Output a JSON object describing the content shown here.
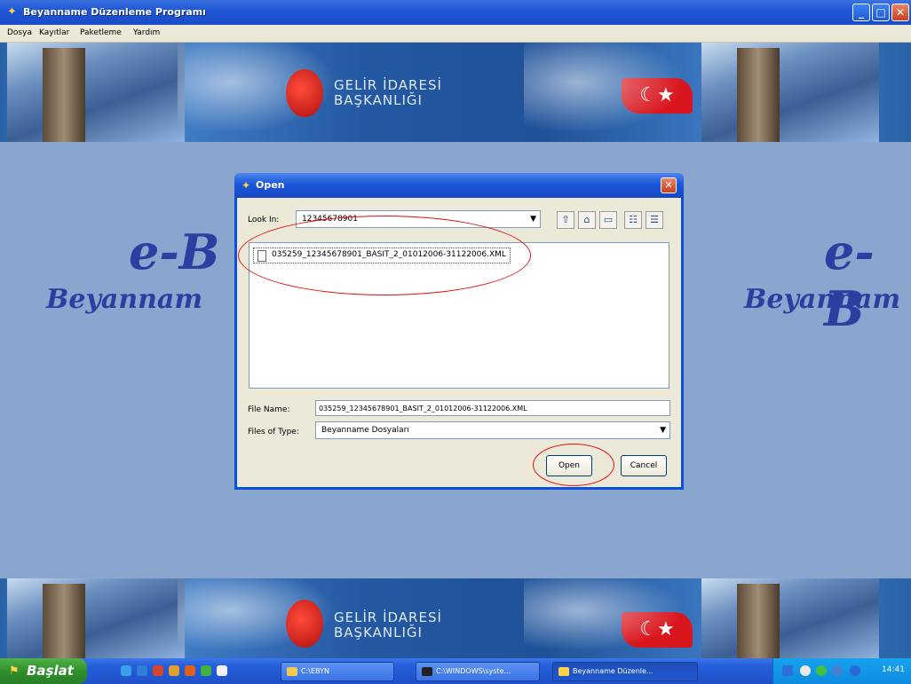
{
  "window": {
    "title": "Beyanname Düzenleme Programı",
    "min_glyph": "_",
    "max_glyph": "□",
    "close_glyph": "✕"
  },
  "menu": [
    "Dosya",
    "Kayıtlar",
    "Paketleme",
    "Yardım"
  ],
  "banner": {
    "logo_line1": "GELİR İDARESİ",
    "logo_line2": "BAŞKANLIĞI",
    "flag_glyph": "☾★"
  },
  "background": {
    "left_big": "e-B",
    "left_sub": "Beyannam",
    "right_big": "e-B",
    "right_sub": "Beyannam"
  },
  "dialog": {
    "title": "Open",
    "look_in_label": "Look In:",
    "look_in_value": "12345678901",
    "files": [
      "035259_12345678901_BASIT_2_01012006-31122006.XML"
    ],
    "file_name_label": "File Name:",
    "file_name_value": "035259_12345678901_BASIT_2_01012006-31122006.XML",
    "files_of_type_label": "Files of Type:",
    "files_of_type_value": "Beyanname Dosyaları",
    "open_label": "Open",
    "cancel_label": "Cancel",
    "tool_icons": [
      "up-folder-icon",
      "home-icon",
      "new-folder-icon",
      "list-view-icon",
      "details-view-icon"
    ]
  },
  "taskbar": {
    "start_label": "Başlat",
    "tasks": [
      "C:\\EBYN",
      "C:\\WINDOWS\\syste...",
      "Beyanname Düzenle..."
    ],
    "clock": "14:41"
  },
  "colors": {
    "xp_blue": "#1f56d6",
    "annotation_red": "#e01010",
    "desktop_bg": "#8aa6cf"
  }
}
